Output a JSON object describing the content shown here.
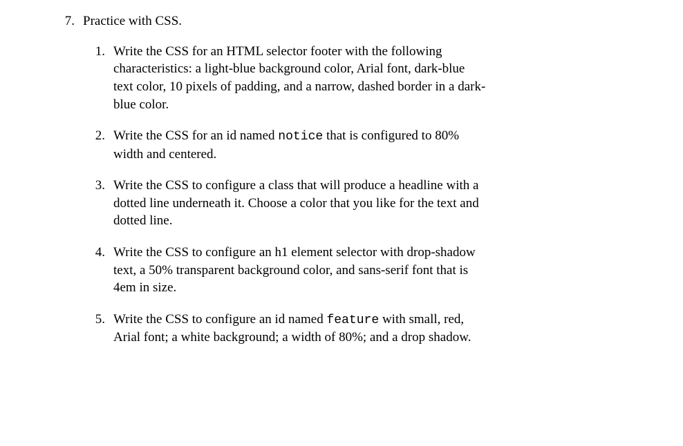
{
  "main": {
    "marker": "7.",
    "title": "Practice with CSS."
  },
  "items": [
    {
      "marker": "1.",
      "text": "Write the CSS for an HTML selector footer with the following characteristics: a light-blue background color, Arial font, dark-blue text color, 10 pixels of padding, and a narrow, dashed border in a dark-blue color."
    },
    {
      "marker": "2.",
      "pre": "Write the CSS for an id named ",
      "code": "notice",
      "post": " that is configured to 80% width and centered."
    },
    {
      "marker": "3.",
      "text": "Write the CSS to configure a class that will produce a headline with a dotted line underneath it. Choose a color that you like for the text and dotted line."
    },
    {
      "marker": "4.",
      "text": "Write the CSS to configure an h1 element selector with drop-shadow text, a 50% transparent background color, and sans-serif font that is 4em in size."
    },
    {
      "marker": "5.",
      "pre": "Write the CSS to configure an id named ",
      "code": "feature",
      "post": " with small, red, Arial font; a white background; a width of 80%; and a drop shadow."
    }
  ]
}
